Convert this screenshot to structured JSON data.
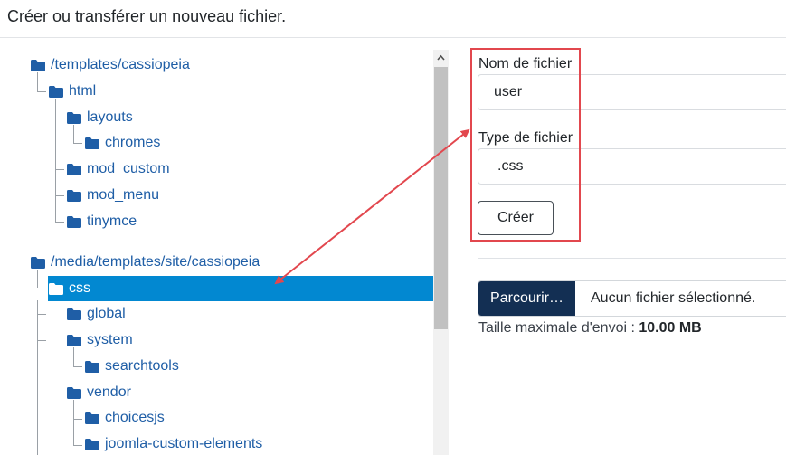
{
  "header": {
    "title": "Créer ou transférer un nouveau fichier."
  },
  "tree": {
    "items": [
      {
        "label": "/templates/cassiopeia"
      },
      {
        "label": "html"
      },
      {
        "label": "layouts"
      },
      {
        "label": "chromes"
      },
      {
        "label": "mod_custom"
      },
      {
        "label": "mod_menu"
      },
      {
        "label": "tinymce"
      },
      {
        "label": "/media/templates/site/cassiopeia"
      },
      {
        "label": "css"
      },
      {
        "label": "global"
      },
      {
        "label": "system"
      },
      {
        "label": "searchtools"
      },
      {
        "label": "vendor"
      },
      {
        "label": "choicesjs"
      },
      {
        "label": "joomla-custom-elements"
      }
    ],
    "selected": "css"
  },
  "form": {
    "filename_label": "Nom de fichier",
    "filename_value": "user",
    "filetype_label": "Type de fichier",
    "filetype_value": ".css",
    "create_button": "Créer"
  },
  "upload": {
    "browse_button": "Parcourir…",
    "no_file": "Aucun fichier sélectionné.",
    "max_size_label": "Taille maximale d'envoi : ",
    "max_size_value": "10.00 MB"
  },
  "colors": {
    "folder": "#1f5ea6",
    "selected_bg": "#0288d1",
    "annotation": "#e2474e",
    "browse_bg": "#132f53"
  }
}
